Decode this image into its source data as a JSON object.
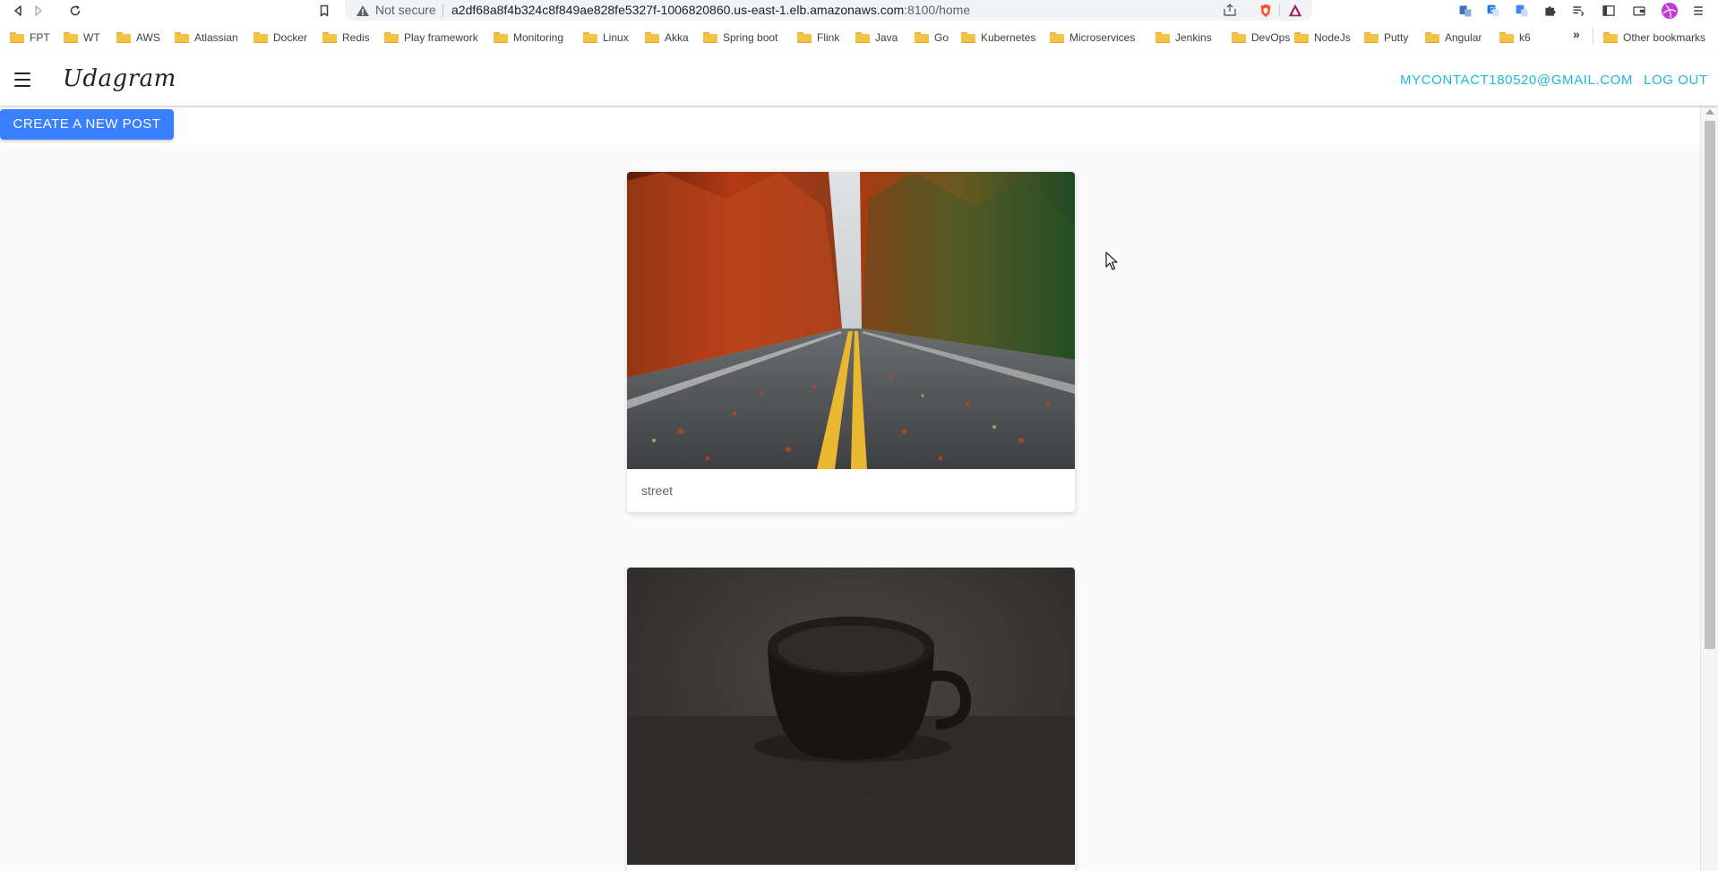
{
  "browser": {
    "security_label": "Not secure",
    "url_host": "a2df68a8f4b324c8f849ae828fe5327f-1006820860.us-east-1.elb.amazonaws.com",
    "url_rest": ":8100/home",
    "bookmarks": [
      "FPT",
      "WT",
      "AWS",
      "Atlassian",
      "Docker",
      "Redis",
      "Play framework",
      "Monitoring",
      "Linux",
      "Akka",
      "Spring boot",
      "Flink",
      "Java",
      "Go",
      "Kubernetes",
      "Microservices",
      "Jenkins",
      "DevOps",
      "NodeJs",
      "Putty",
      "Angular",
      "k6"
    ],
    "more_bookmarks": "»",
    "other_bookmarks": "Other bookmarks"
  },
  "app": {
    "brand": "Udagram",
    "user_email": "MYCONTACT180520@GMAIL.COM",
    "logout_label": "LOG OUT",
    "create_post_label": "CREATE A NEW POST"
  },
  "feed": {
    "posts": [
      {
        "caption": "street",
        "image": "autumn-road-photo"
      },
      {
        "caption": "",
        "image": "coffee-cup-photo"
      }
    ]
  },
  "colors": {
    "accent": "#1fb6e0",
    "primary_button": "#3880ff",
    "page_background": "#fafafa"
  }
}
